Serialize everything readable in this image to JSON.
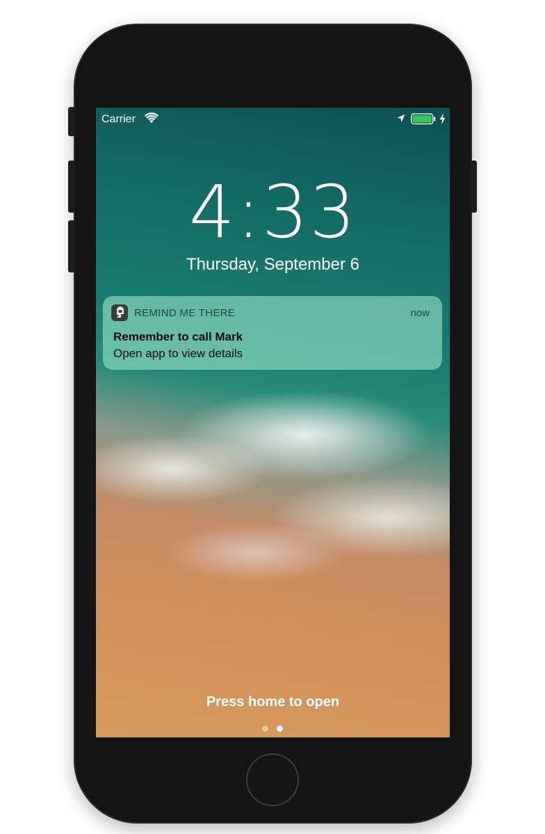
{
  "status_bar": {
    "carrier": "Carrier",
    "icons": [
      "wifi-icon",
      "location-icon",
      "battery-icon",
      "charging-bolt-icon"
    ],
    "battery_color": "#34c759"
  },
  "lock_screen": {
    "time": "4:33",
    "date": "Thursday, September 6"
  },
  "notification": {
    "app_name": "REMIND ME THERE",
    "timestamp": "now",
    "title": "Remember to call Mark",
    "body": "Open app to view details",
    "icon": "app-icon"
  },
  "footer": {
    "hint": "Press home to open",
    "pages": 2,
    "active_page": 2
  }
}
